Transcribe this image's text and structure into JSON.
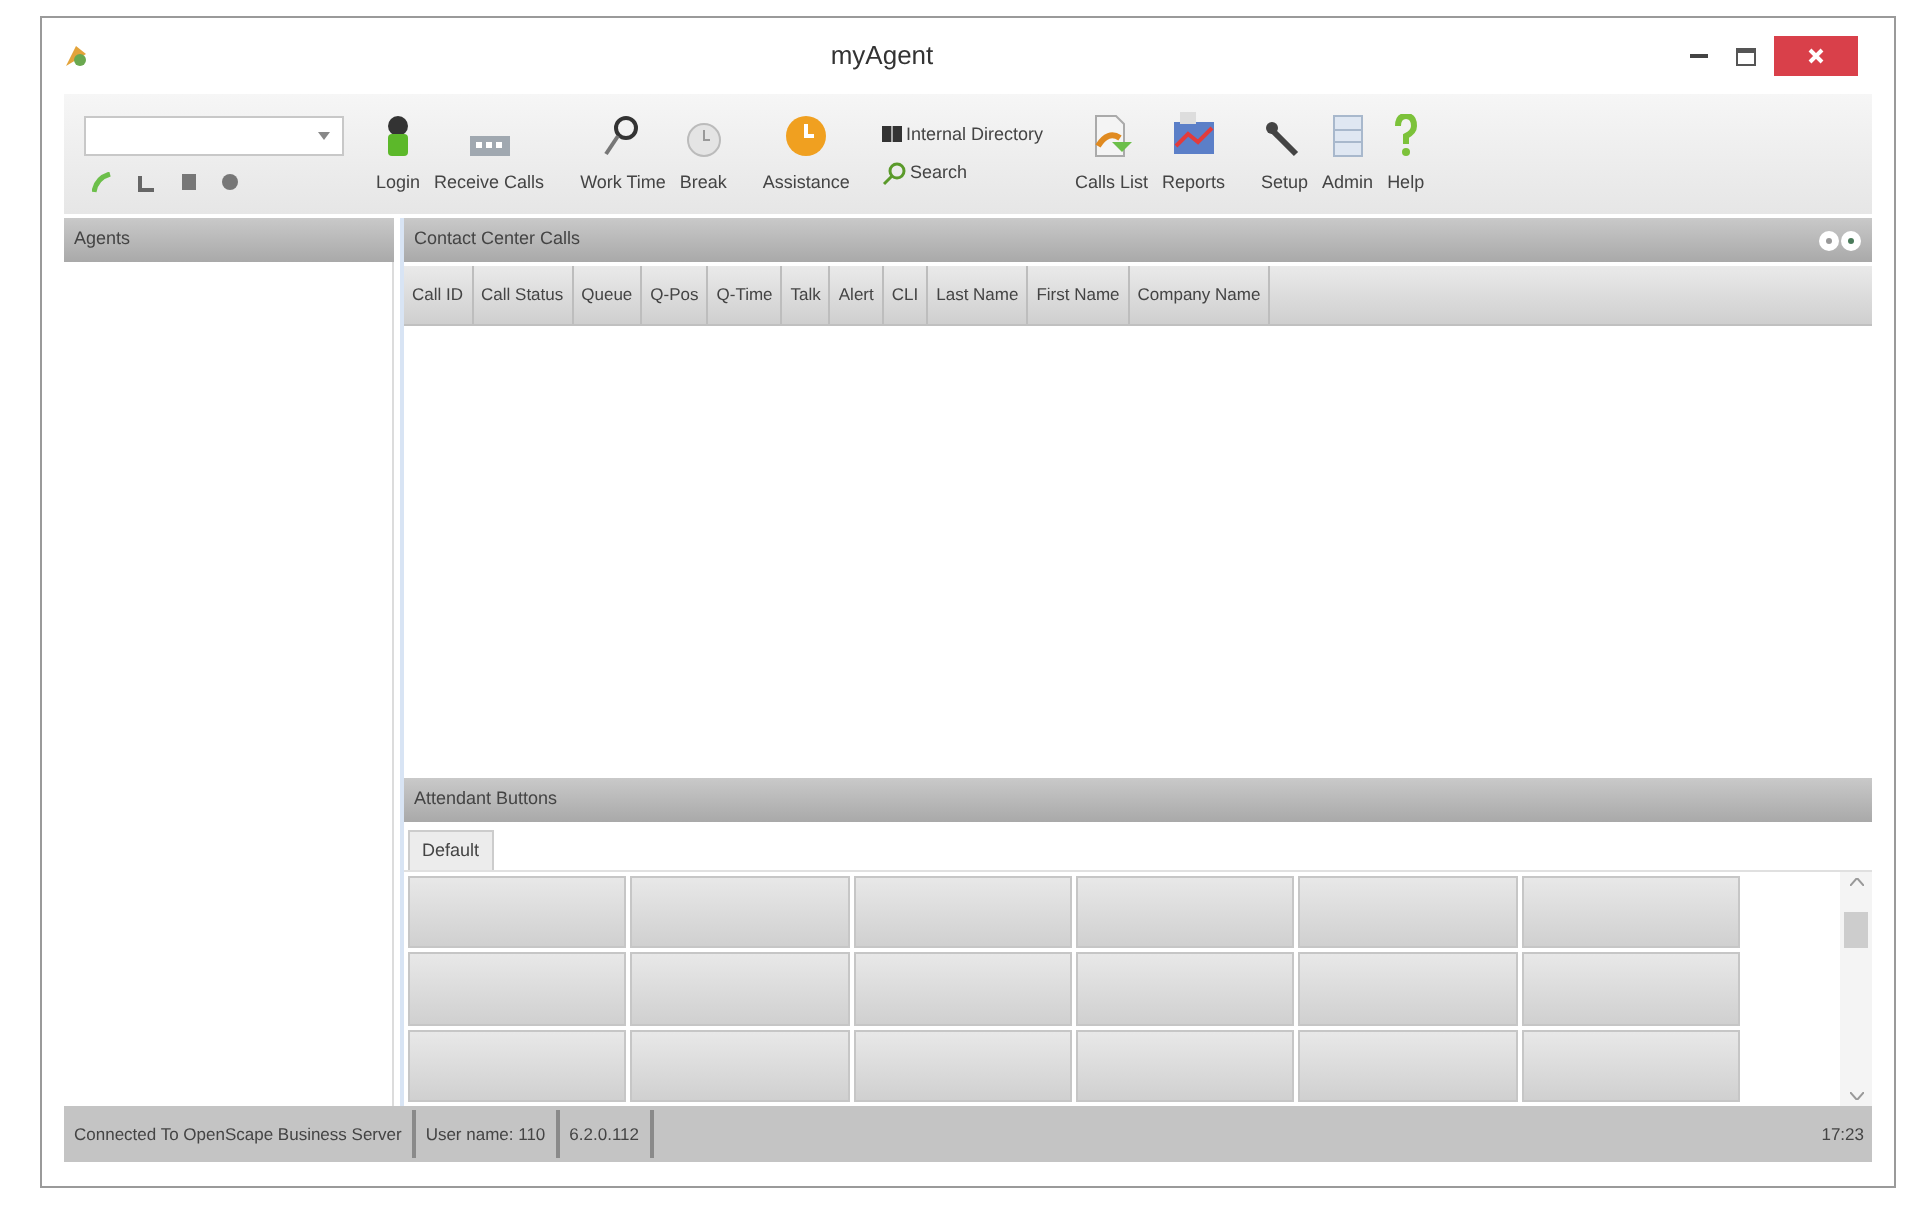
{
  "window": {
    "title": "myAgent"
  },
  "toolbar": {
    "groups": [
      {
        "items": [
          {
            "kind": "login",
            "label": "Login"
          },
          {
            "kind": "receive",
            "label": "Receive Calls"
          }
        ]
      },
      {
        "items": [
          {
            "kind": "worktime",
            "label": "Work Time"
          },
          {
            "kind": "break",
            "label": "Break"
          }
        ]
      },
      {
        "items": [
          {
            "kind": "assistance",
            "label": "Assistance"
          }
        ]
      },
      {
        "small": [
          {
            "kind": "directory",
            "label": "Internal Directory"
          },
          {
            "kind": "search",
            "label": "Search"
          }
        ]
      },
      {
        "items": [
          {
            "kind": "callslist",
            "label": "Calls List"
          },
          {
            "kind": "reports",
            "label": "Reports"
          }
        ]
      },
      {
        "items": [
          {
            "kind": "setup",
            "label": "Setup"
          },
          {
            "kind": "admin",
            "label": "Admin"
          },
          {
            "kind": "help",
            "label": "Help"
          }
        ]
      }
    ]
  },
  "agents_panel": {
    "title": "Agents"
  },
  "calls_panel": {
    "title": "Contact Center Calls",
    "columns": [
      "Call ID",
      "Call Status",
      "Queue",
      "Q-Pos",
      "Q-Time",
      "Talk",
      "Alert",
      "CLI",
      "Last Name",
      "First Name",
      "Company Name"
    ]
  },
  "attendant_panel": {
    "title": "Attendant Buttons",
    "tabs": [
      {
        "label": "Default",
        "selected": true
      }
    ]
  },
  "status_bar": [
    "Connected To OpenScape Business Server",
    "User name: 110",
    "6.2.0.112"
  ],
  "clock": "17:23"
}
